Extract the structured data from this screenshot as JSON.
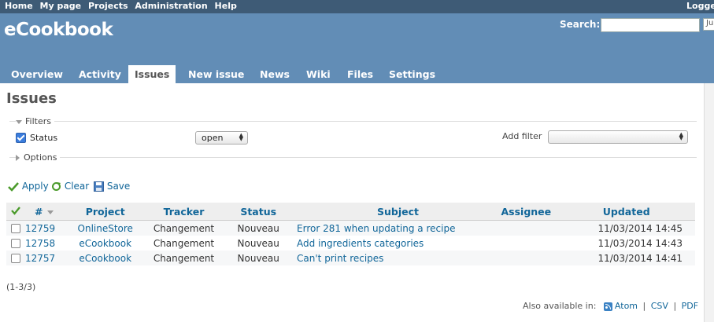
{
  "top_menu": {
    "items": [
      "Home",
      "My page",
      "Projects",
      "Administration",
      "Help"
    ],
    "logged_text": "Logged"
  },
  "header": {
    "project_title": "eCookbook",
    "search_label": "Search:",
    "search_value": "",
    "jump_text": "Ju"
  },
  "tabs": [
    {
      "label": "Overview",
      "selected": false
    },
    {
      "label": "Activity",
      "selected": false
    },
    {
      "label": "Issues",
      "selected": true
    },
    {
      "label": "New issue",
      "selected": false
    },
    {
      "label": "News",
      "selected": false
    },
    {
      "label": "Wiki",
      "selected": false
    },
    {
      "label": "Files",
      "selected": false
    },
    {
      "label": "Settings",
      "selected": false
    }
  ],
  "page": {
    "title": "Issues",
    "filters_legend": "Filters",
    "status_label": "Status",
    "status_operator": "open",
    "add_filter_label": "Add filter",
    "add_filter_value": "",
    "options_legend": "Options"
  },
  "actions": {
    "apply": "Apply",
    "clear": "Clear",
    "save": "Save"
  },
  "table": {
    "columns": [
      "#",
      "Project",
      "Tracker",
      "Status",
      "Subject",
      "Assignee",
      "Updated"
    ],
    "rows": [
      {
        "id": "12759",
        "project": "OnlineStore",
        "tracker": "Changement",
        "status": "Nouveau",
        "subject": "Error 281 when updating a recipe",
        "assignee": "",
        "updated": "11/03/2014 14:45"
      },
      {
        "id": "12758",
        "project": "eCookbook",
        "tracker": "Changement",
        "status": "Nouveau",
        "subject": "Add ingredients categories",
        "assignee": "",
        "updated": "11/03/2014 14:43"
      },
      {
        "id": "12757",
        "project": "eCookbook",
        "tracker": "Changement",
        "status": "Nouveau",
        "subject": "Can't print recipes",
        "assignee": "",
        "updated": "11/03/2014 14:41"
      }
    ]
  },
  "pagination": "(1-3/3)",
  "other_formats": {
    "label": "Also available in:",
    "atom": "Atom",
    "csv": "CSV",
    "pdf": "PDF",
    "sep": "|"
  },
  "colors": {
    "header_bg": "#628db6",
    "top_menu_bg": "#3e5b76",
    "link": "#169"
  }
}
